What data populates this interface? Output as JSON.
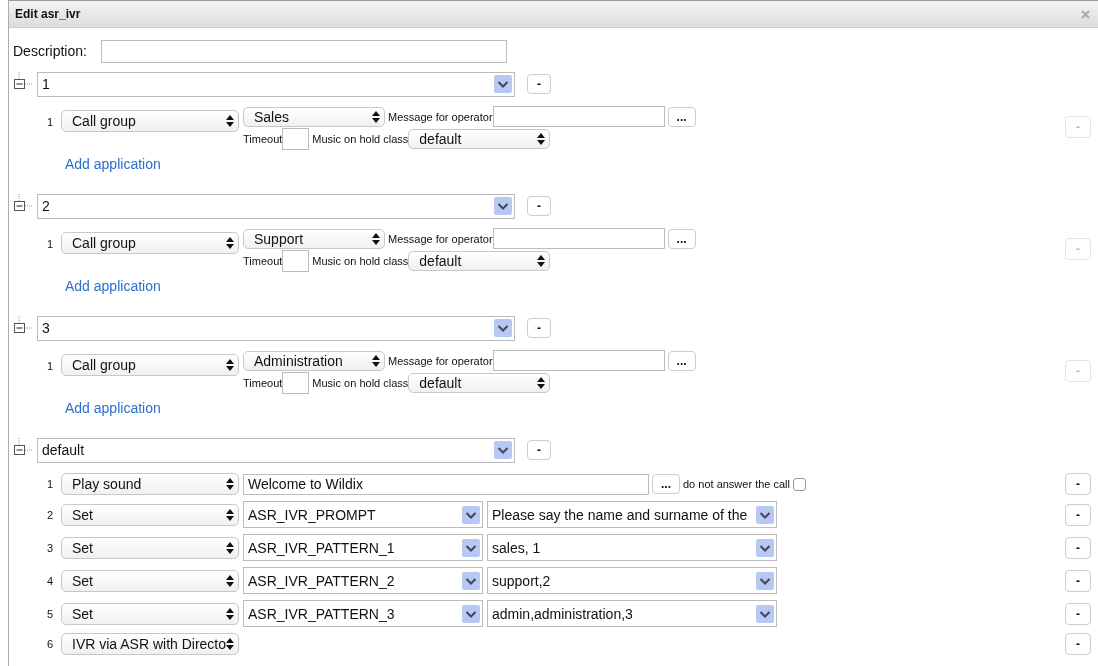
{
  "window": {
    "title": "Edit asr_ivr"
  },
  "description": {
    "label": "Description:"
  },
  "groups": [
    {
      "value": "1",
      "expanded": true,
      "remove": "-",
      "add_link": "Add application",
      "applications": [
        {
          "number": "1",
          "kind": "call_group",
          "type": "Call group",
          "group": "Sales",
          "message_label": "Message for operator",
          "more": "...",
          "timeout_label": "Timeout",
          "moh_label": "Music on hold class",
          "moh": "default",
          "remove": "-",
          "disabled": true
        }
      ]
    },
    {
      "value": "2",
      "expanded": true,
      "remove": "-",
      "add_link": "Add application",
      "applications": [
        {
          "number": "1",
          "kind": "call_group",
          "type": "Call group",
          "group": "Support",
          "message_label": "Message for operator",
          "more": "...",
          "timeout_label": "Timeout",
          "moh_label": "Music on hold class",
          "moh": "default",
          "remove": "-",
          "disabled": true
        }
      ]
    },
    {
      "value": "3",
      "expanded": true,
      "remove": "-",
      "add_link": "Add application",
      "applications": [
        {
          "number": "1",
          "kind": "call_group",
          "type": "Call group",
          "group": "Administration",
          "message_label": "Message for operator",
          "more": "...",
          "timeout_label": "Timeout",
          "moh_label": "Music on hold class",
          "moh": "default",
          "remove": "-",
          "disabled": true
        }
      ]
    },
    {
      "value": "default",
      "expanded": true,
      "remove": "-",
      "applications": [
        {
          "number": "1",
          "kind": "play_sound",
          "type": "Play sound",
          "sound": "Welcome to Wildix",
          "more": "...",
          "option_label": "do not answer the call",
          "checked": false,
          "remove": "-",
          "disabled": false
        },
        {
          "number": "2",
          "kind": "set",
          "type": "Set",
          "variable": "ASR_IVR_PROMPT",
          "value": "Please say the name and surname of the",
          "remove": "-",
          "disabled": false
        },
        {
          "number": "3",
          "kind": "set",
          "type": "Set",
          "variable": "ASR_IVR_PATTERN_1",
          "value": "sales, 1",
          "remove": "-",
          "disabled": false
        },
        {
          "number": "4",
          "kind": "set",
          "type": "Set",
          "variable": "ASR_IVR_PATTERN_2",
          "value": "support,2",
          "remove": "-",
          "disabled": false
        },
        {
          "number": "5",
          "kind": "set",
          "type": "Set",
          "variable": "ASR_IVR_PATTERN_3",
          "value": "admin,administration,3",
          "remove": "-",
          "disabled": false
        },
        {
          "number": "6",
          "kind": "other",
          "type": "IVR via ASR with Directo",
          "remove": "-",
          "disabled": false
        }
      ]
    }
  ]
}
